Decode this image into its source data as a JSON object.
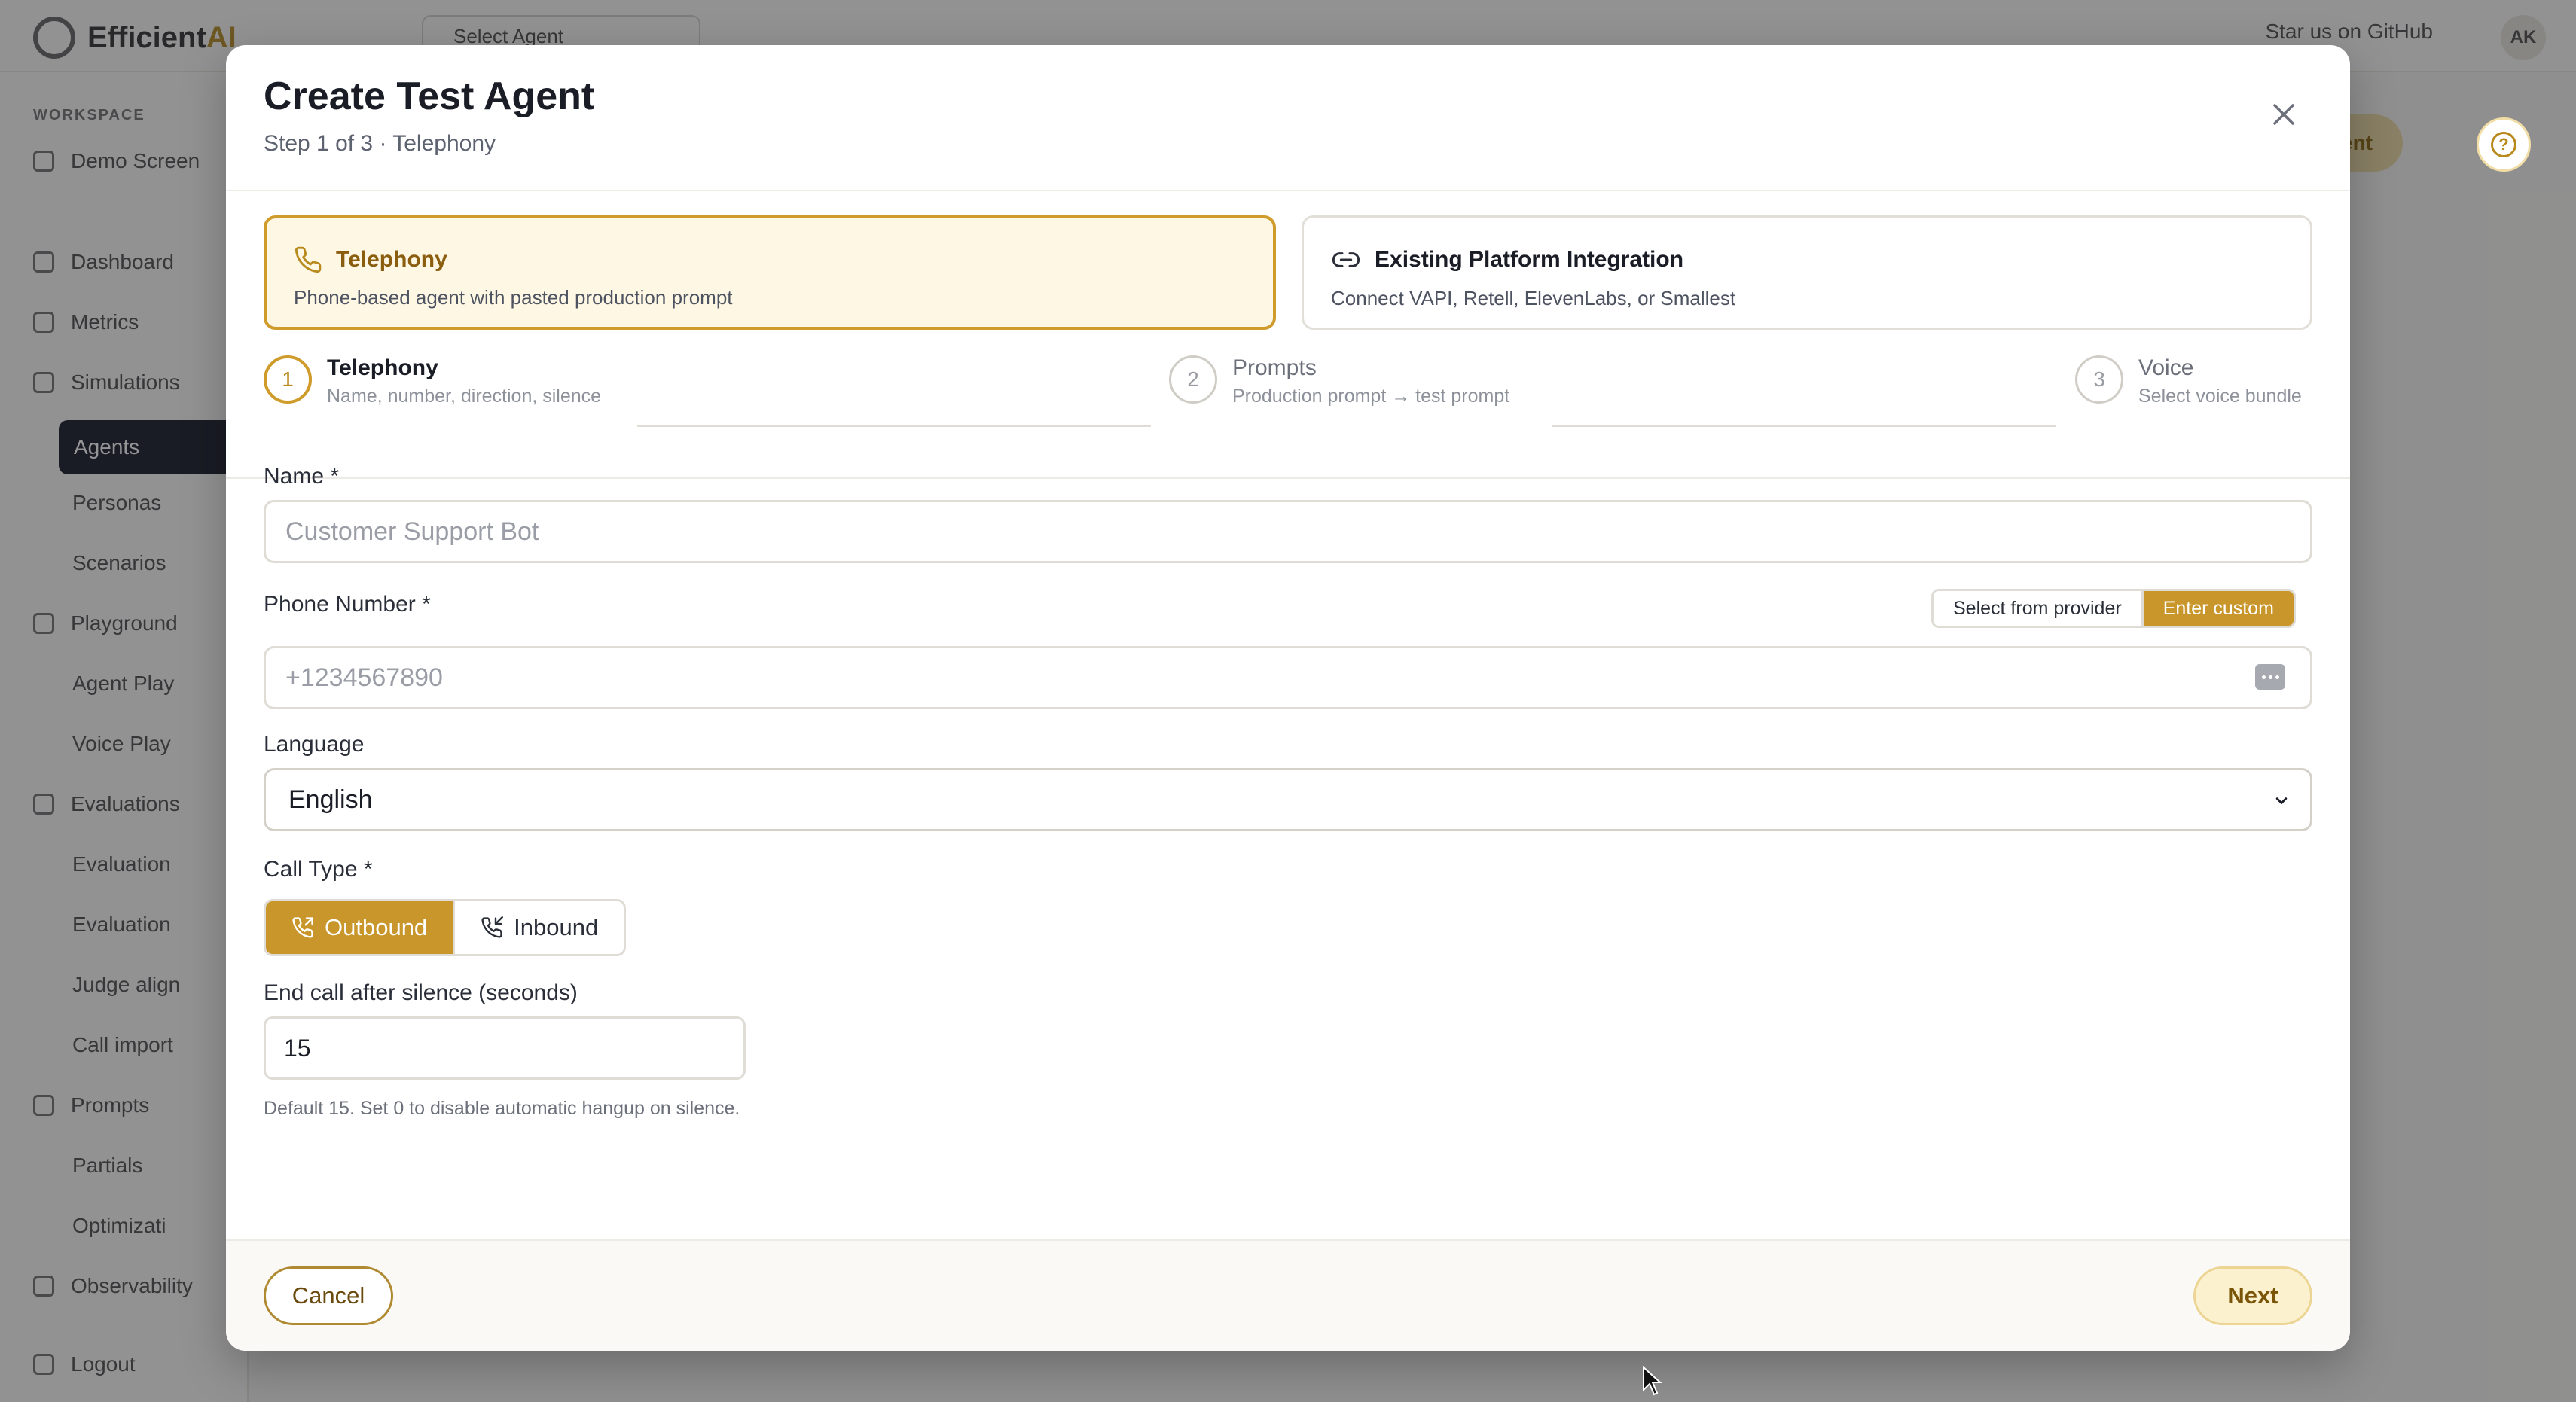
{
  "background": {
    "brand_prefix": "Efficient",
    "brand_suffix": "AI",
    "agent_select": "Select Agent",
    "star_link": "Star us on GitHub",
    "user_initials": "AK",
    "sidebar": {
      "section_label": "WORKSPACE",
      "workspace_name": "Demo Screen",
      "items": [
        {
          "label": "Dashboard"
        },
        {
          "label": "Metrics"
        },
        {
          "label": "Simulations"
        },
        {
          "label": "Agents"
        },
        {
          "label": "Personas"
        },
        {
          "label": "Scenarios"
        },
        {
          "label": "Playground"
        },
        {
          "label": "Agent Play"
        },
        {
          "label": "Voice Play"
        },
        {
          "label": "Evaluations"
        },
        {
          "label": "Evaluation"
        },
        {
          "label": "Evaluation"
        },
        {
          "label": "Judge align"
        },
        {
          "label": "Call import"
        },
        {
          "label": "Prompts"
        },
        {
          "label": "Partials"
        },
        {
          "label": "Optimizati"
        },
        {
          "label": "Observability"
        },
        {
          "label": "Logout"
        }
      ]
    },
    "cta_label": "Agent"
  },
  "modal": {
    "title": "Create Test Agent",
    "subtitle": "Step 1 of 3 · Telephony",
    "modes": [
      {
        "title": "Telephony",
        "description": "Phone-based agent with pasted production prompt",
        "icon": "phone-icon"
      },
      {
        "title": "Existing Platform Integration",
        "description": "Connect VAPI, Retell, ElevenLabs, or Smallest",
        "icon": "link-icon"
      }
    ],
    "steps": [
      {
        "number": "1",
        "title": "Telephony",
        "subtitle": "Name, number, direction, silence"
      },
      {
        "number": "2",
        "title": "Prompts",
        "subtitle": "Production prompt → test prompt"
      },
      {
        "number": "3",
        "title": "Voice",
        "subtitle": "Select voice bundle"
      }
    ],
    "form": {
      "name_label": "Name *",
      "name_placeholder": "Customer Support Bot",
      "name_value": "",
      "phone_label": "Phone Number *",
      "phone_toggle": [
        "Select from provider",
        "Enter custom"
      ],
      "phone_placeholder": "+1234567890",
      "phone_value": "",
      "language_label": "Language",
      "language_value": "English",
      "call_type_label": "Call Type *",
      "call_types": [
        "Outbound",
        "Inbound"
      ],
      "silence_label": "End call after silence (seconds)",
      "silence_value": "15",
      "silence_hint": "Default 15. Set 0 to disable automatic hangup on silence."
    },
    "footer": {
      "cancel_label": "Cancel",
      "next_label": "Next"
    }
  },
  "colors": {
    "accent": "#c8962a",
    "accent_light": "#fdf7e4",
    "text_dark": "#1a1d26"
  }
}
